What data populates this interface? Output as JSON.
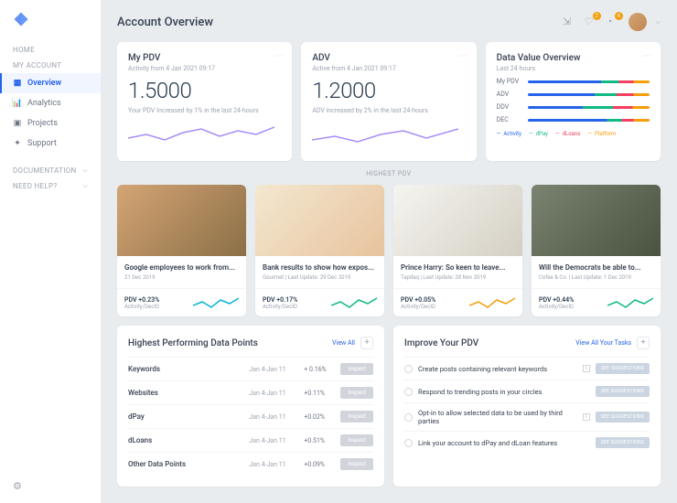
{
  "page": {
    "title": "Account Overview"
  },
  "sidebar": {
    "groups": [
      {
        "label": "HOME"
      },
      {
        "label": "MY ACCOUNT",
        "items": [
          {
            "label": "Overview",
            "active": true
          },
          {
            "label": "Analytics"
          },
          {
            "label": "Projects"
          },
          {
            "label": "Support"
          }
        ]
      },
      {
        "label": "DOCUMENTATION"
      },
      {
        "label": "NEED HELP?"
      }
    ]
  },
  "topbar": {
    "notif1": "2",
    "notif2": "4"
  },
  "metrics": {
    "pdv": {
      "title": "My PDV",
      "sub": "Activity from 4 Jan 2021  09:17",
      "value": "1.5000",
      "note": "Your PDV Increased by 1% in the last 24-hours"
    },
    "adv": {
      "title": "ADV",
      "sub": "Active from 4 Jan 2021  09:17",
      "value": "1.2000",
      "note": "ADV increased by 2% in the last 24-hours"
    }
  },
  "dataValue": {
    "title": "Data Value Overview",
    "sub": "Last 24 hours",
    "rows": [
      {
        "label": "My PDV"
      },
      {
        "label": "ADV"
      },
      {
        "label": "DDV"
      },
      {
        "label": "DEC"
      }
    ],
    "legend": [
      "Activity",
      "dPay",
      "dLoans",
      "Platform"
    ]
  },
  "highestLabel": "HIGHEST PDV",
  "articles": [
    {
      "title": "Google employees to work from...",
      "meta": "21 Dec 2019",
      "pdv": "PDV +0.23%",
      "sub": "Activity/DecID"
    },
    {
      "title": "Bank results to show how expos...",
      "meta": "Gourmet | Last Update: 29 Dec 2019",
      "pdv": "PDV +0.17%",
      "sub": "Activity/DecID"
    },
    {
      "title": "Prince Harry: So keen to leave...",
      "meta": "Tapdaq | Last Update: 28 Nov 2019",
      "pdv": "PDV +0.05%",
      "sub": "Activity/DecID"
    },
    {
      "title": "Will the Democrats be able to...",
      "meta": "Cofee & Co. | Last Update: 1 Dec 2019",
      "pdv": "PDV +0.44%",
      "sub": "Activity/DecID"
    }
  ],
  "dataPoints": {
    "title": "Highest Performing Data Points",
    "viewAll": "View All",
    "inspect": "Inspect",
    "rows": [
      {
        "name": "Keywords",
        "date": "Jan 4-Jan 11",
        "val": "+ 0.16%"
      },
      {
        "name": "Websites",
        "date": "Jan 4-Jan 11",
        "val": "+0.11%"
      },
      {
        "name": "dPay",
        "date": "Jan 4-Jan 11",
        "val": "+0.02%"
      },
      {
        "name": "dLoans",
        "date": "Jan 4-Jan 11",
        "val": "+0.51%"
      },
      {
        "name": "Other Data Points",
        "date": "Jan 4-Jan 11",
        "val": "+0.09%"
      }
    ]
  },
  "improve": {
    "title": "Improve Your PDV",
    "viewAll": "View All Your Tasks",
    "sugg": "SEE SUGGESTIONS",
    "tasks": [
      {
        "text": "Create posts containing relevant keywords",
        "info": true
      },
      {
        "text": "Respond to trending posts in your circles"
      },
      {
        "text": "Opt-in to allow selected data to be used by third parties",
        "info": true
      },
      {
        "text": "Link your account to dPay and dLoan features"
      }
    ]
  },
  "chart_data": {
    "type": "bar",
    "title": "Data Value Overview",
    "categories": [
      "My PDV",
      "ADV",
      "DDV",
      "DEC"
    ],
    "series": [
      {
        "name": "Activity",
        "values": [
          60,
          55,
          45,
          65
        ],
        "color": "#2563eb"
      },
      {
        "name": "dPay",
        "values": [
          15,
          18,
          25,
          12
        ],
        "color": "#10b981"
      },
      {
        "name": "dLoans",
        "values": [
          12,
          14,
          16,
          10
        ],
        "color": "#f43f5e"
      },
      {
        "name": "Platform",
        "values": [
          13,
          13,
          14,
          13
        ],
        "color": "#f59e0b"
      }
    ]
  }
}
